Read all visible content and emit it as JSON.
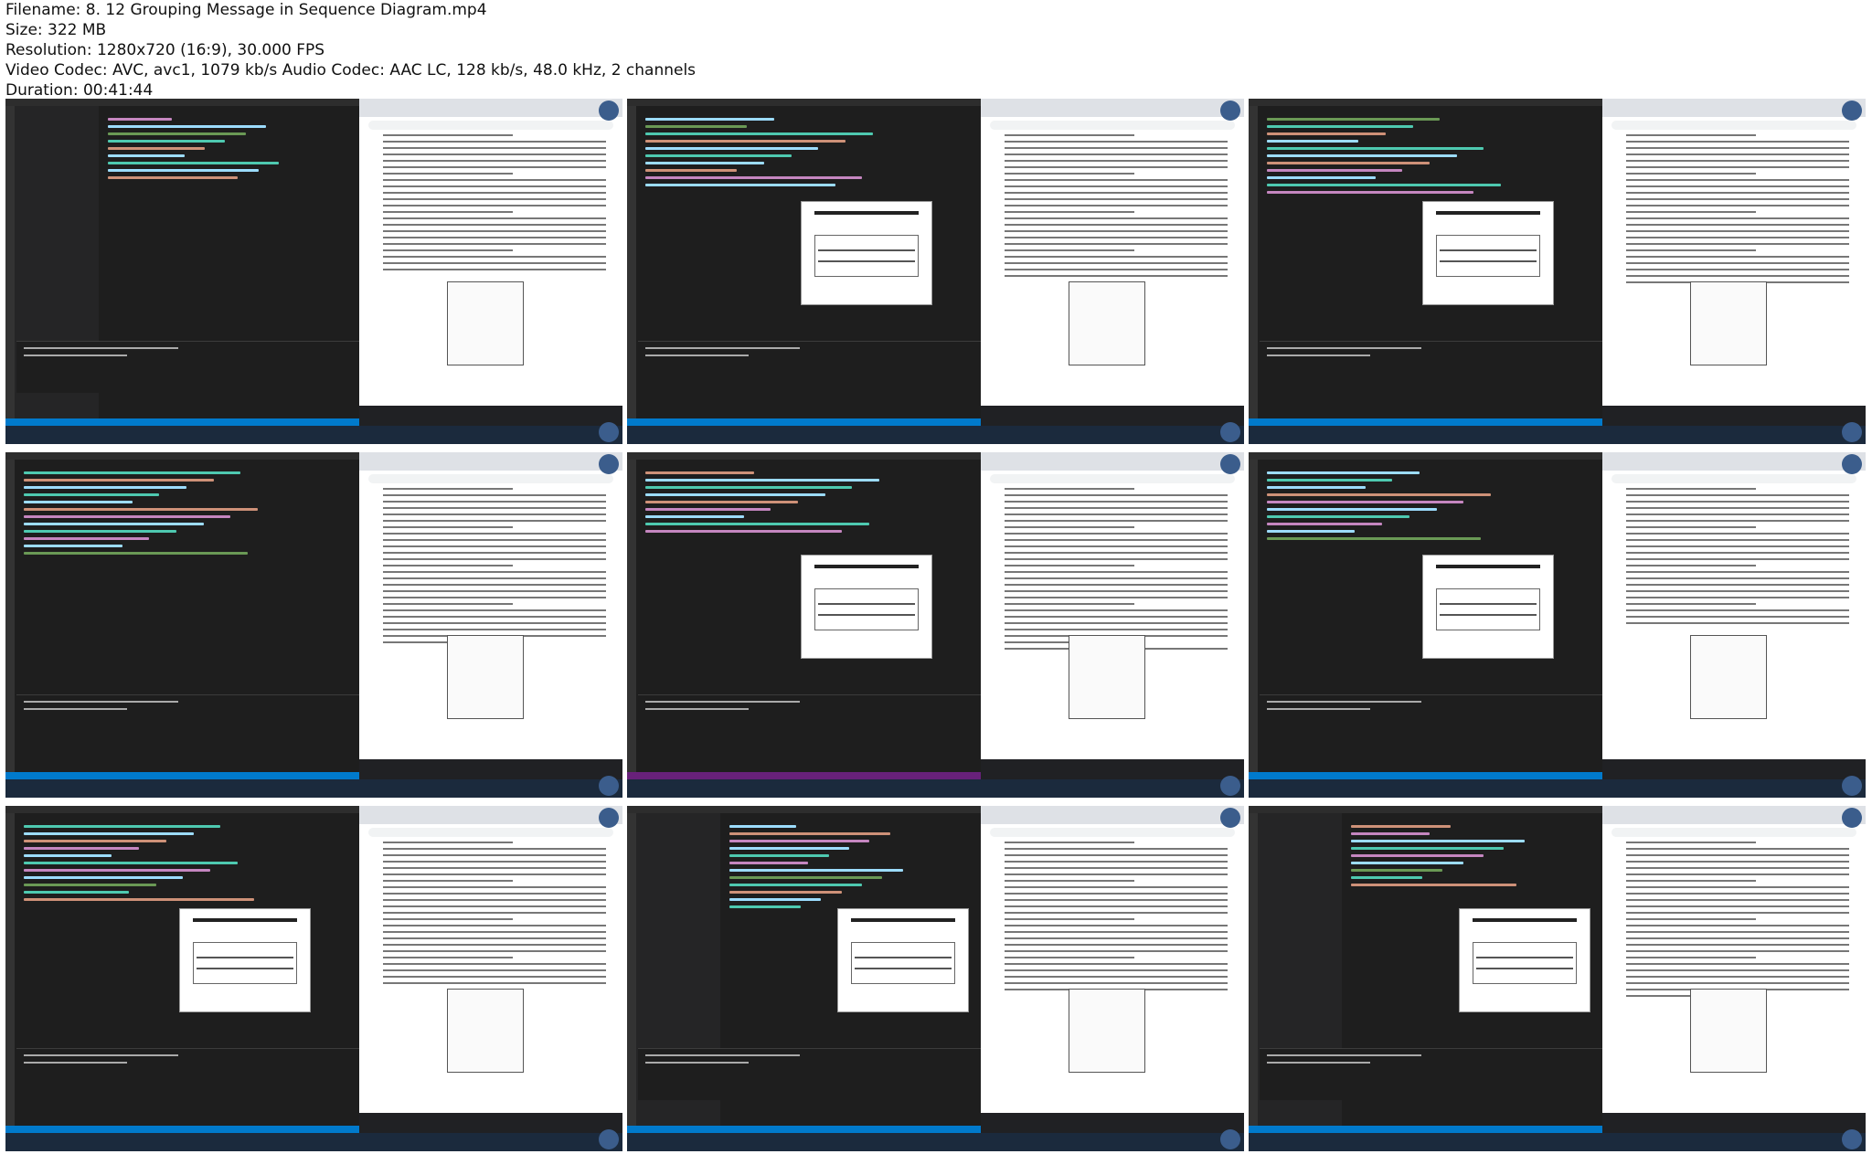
{
  "info": {
    "filename": "Filename: 8. 12 Grouping Message in Sequence Diagram.mp4",
    "size": "Size: 322 MB",
    "resolution": "Resolution: 1280x720 (16:9), 30.000 FPS",
    "codec": "Video Codec: AVC, avc1, 1079 kb/s Audio Codec: AAC LC, 128 kb/s, 48.0 kHz, 2 channels",
    "duration": "Duration: 00:41:44"
  },
  "colors": {
    "vscode_bg": "#1e1e1e",
    "status_blue": "#007acc",
    "status_purple": "#68217a",
    "taskbar": "#1b2a3d"
  },
  "thumbnails": [
    {
      "variant": "explorer-code-pdf"
    },
    {
      "variant": "code-preview-pdf"
    },
    {
      "variant": "code-preview-pdf"
    },
    {
      "variant": "code-pdf"
    },
    {
      "variant": "code-preview-pdf"
    },
    {
      "variant": "code-preview-pdf"
    },
    {
      "variant": "code-preview-pdf"
    },
    {
      "variant": "explorer-code-preview-pdf"
    },
    {
      "variant": "explorer-code-preview-pdf"
    }
  ]
}
